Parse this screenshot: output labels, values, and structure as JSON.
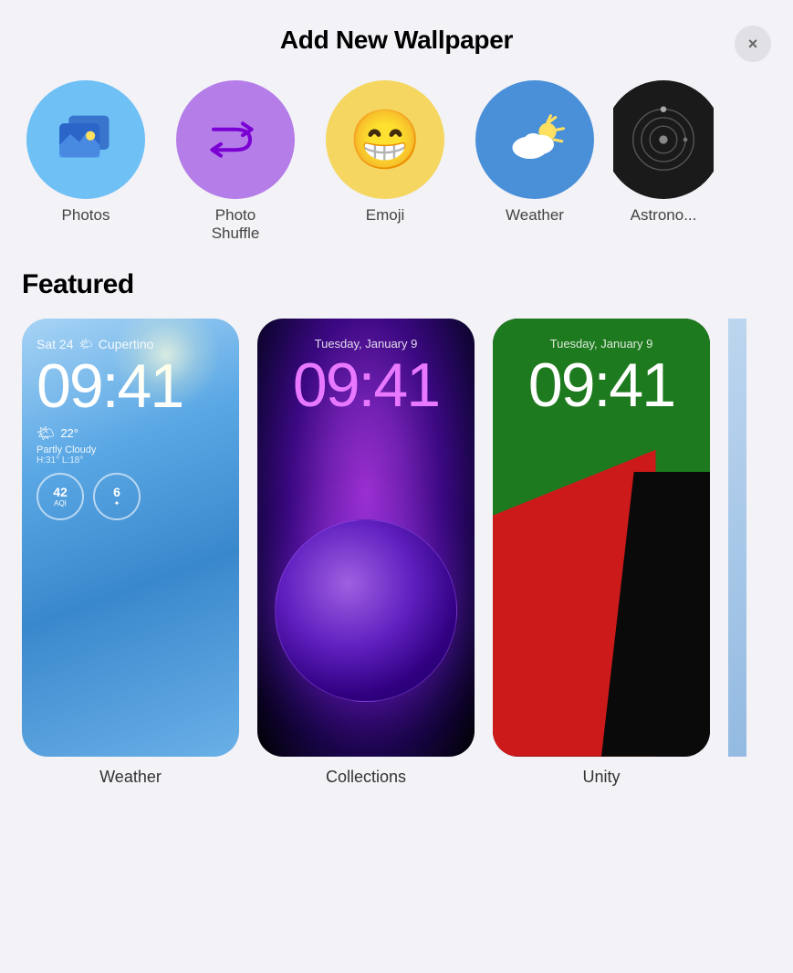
{
  "header": {
    "title": "Add New Wallpaper",
    "close_label": "×"
  },
  "categories": [
    {
      "id": "photos",
      "label": "Photos",
      "type": "photos"
    },
    {
      "id": "photo-shuffle",
      "label": "Photo Shuffle",
      "type": "photo-shuffle"
    },
    {
      "id": "emoji",
      "label": "Emoji",
      "type": "emoji",
      "emoji": "😁"
    },
    {
      "id": "weather",
      "label": "Weather",
      "type": "weather"
    },
    {
      "id": "astronomy",
      "label": "Astronomy",
      "type": "astronomy"
    }
  ],
  "featured": {
    "title": "Featured",
    "wallpapers": [
      {
        "id": "weather-wallpaper",
        "name": "Weather",
        "date": "Sat 24",
        "location": "Cupertino",
        "time": "09:41",
        "weather_desc": "22°",
        "weather_sub": "Partly Cloudy",
        "weather_range": "H:31° L:18°",
        "widget1_value": "42",
        "widget1_label": "AQI",
        "widget2_value": "6",
        "widget2_label": ""
      },
      {
        "id": "collections-wallpaper",
        "name": "Collections",
        "date": "Tuesday, January 9",
        "time": "09:41"
      },
      {
        "id": "unity-wallpaper",
        "name": "Unity",
        "date": "Tuesday, January 9",
        "time": "09:41"
      }
    ]
  }
}
